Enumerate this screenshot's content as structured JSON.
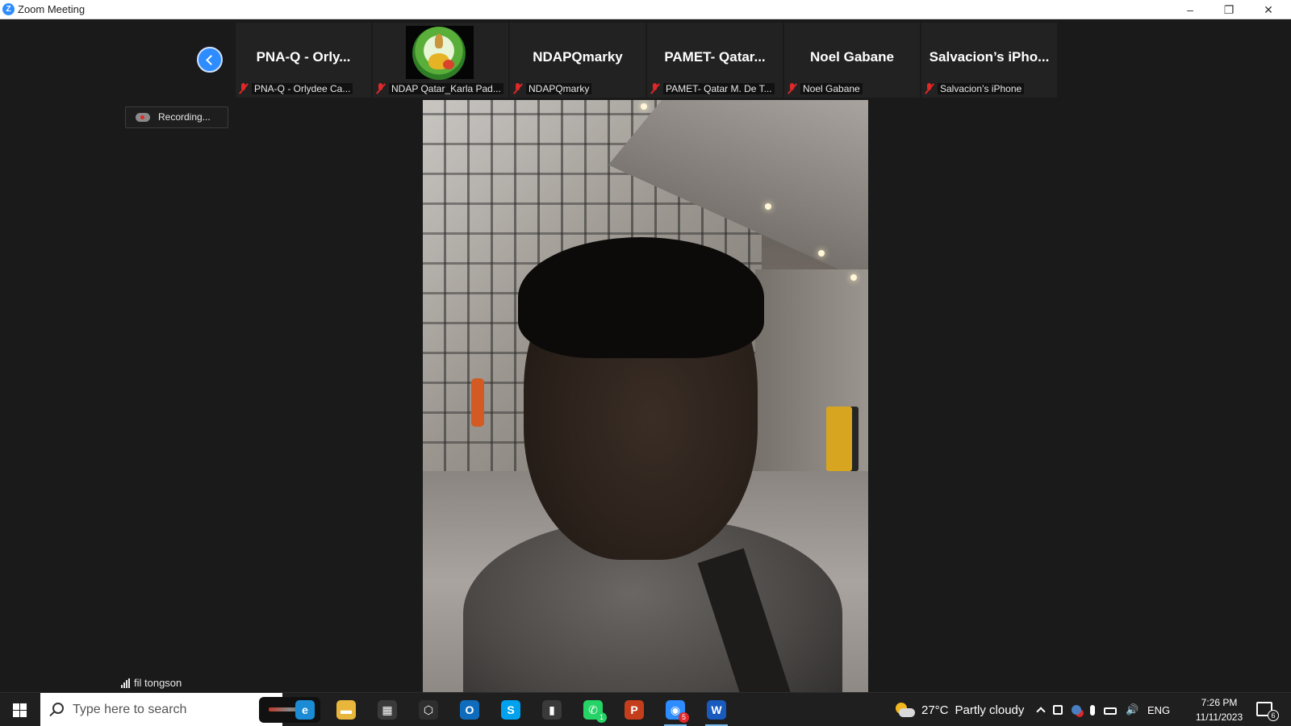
{
  "window": {
    "title": "Zoom Meeting",
    "minimize_glyph": "–",
    "restore_glyph": "❐",
    "close_glyph": "✕"
  },
  "participants": [
    {
      "name": "PNA-Q   -   Orly...",
      "label": "PNA-Q   -   Orlydee Ca..."
    },
    {
      "name": "",
      "label": "NDAP Qatar_Karla Pad..."
    },
    {
      "name": "NDAPQmarky",
      "label": "NDAPQmarky"
    },
    {
      "name": "PAMET- Qatar...",
      "label": "PAMET- Qatar M. De T..."
    },
    {
      "name": "Noel Gabane",
      "label": "Noel Gabane"
    },
    {
      "name": "Salvacion’s iPho...",
      "label": "Salvacion’s iPhone"
    }
  ],
  "recording": {
    "label": "Recording..."
  },
  "active_speaker": {
    "name": "fil tongson"
  },
  "taskbar": {
    "search_placeholder": "Type here to search",
    "apps": [
      {
        "icon": "edge-icon",
        "glyph": "e",
        "color": "#1c8bd6"
      },
      {
        "icon": "file-explorer-icon",
        "glyph": "▬",
        "color": "#e8b63a"
      },
      {
        "icon": "microsoft-store-icon",
        "glyph": "▦",
        "color": "#3a3a3a"
      },
      {
        "icon": "package-app-icon",
        "glyph": "⬡",
        "color": "#2e2e2e"
      },
      {
        "icon": "outlook-icon",
        "glyph": "O",
        "color": "#0f6cbd"
      },
      {
        "icon": "skype-icon",
        "glyph": "S",
        "color": "#00a2ed"
      },
      {
        "icon": "usb-device-icon",
        "glyph": "▮",
        "color": "#3a3a3a"
      },
      {
        "icon": "whatsapp-icon",
        "glyph": "✆",
        "color": "#25d366",
        "badge": "1"
      },
      {
        "icon": "powerpoint-icon",
        "glyph": "P",
        "color": "#c43e1c"
      },
      {
        "icon": "zoom-icon",
        "glyph": "◉",
        "color": "#2d8cff",
        "badge": "5",
        "active": true
      },
      {
        "icon": "word-icon",
        "glyph": "W",
        "color": "#185abd",
        "active": true
      }
    ],
    "weather": {
      "temp": "27°C",
      "text": "Partly cloudy"
    },
    "language": "ENG",
    "time": "7:26 PM",
    "date": "11/11/2023",
    "notification_count": "6"
  }
}
